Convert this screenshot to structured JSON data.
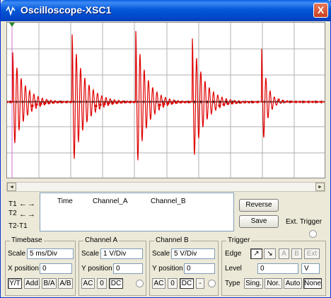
{
  "window": {
    "title": "Oscilloscope-XSC1",
    "close_label": "X"
  },
  "colors": {
    "trace": "#e00000",
    "grid": "#b0b0b0",
    "axis": "#000000",
    "title_bar": "#0458d8"
  },
  "cursors": {
    "t1": "T1",
    "t2": "T2",
    "diff": "T2-T1",
    "left_arrow": "←",
    "right_arrow": "→"
  },
  "readout": {
    "time_header": "Time",
    "channel_a_header": "Channel_A",
    "channel_b_header": "Channel_B"
  },
  "buttons": {
    "reverse": "Reverse",
    "save": "Save",
    "ext_trigger": "Ext. Trigger"
  },
  "timebase": {
    "title": "Timebase",
    "scale_label": "Scale",
    "scale_value": "5 ms/Div",
    "xpos_label": "X position",
    "xpos_value": "0",
    "modes": [
      "Y/T",
      "Add",
      "B/A",
      "A/B"
    ]
  },
  "channel_a": {
    "title": "Channel A",
    "scale_label": "Scale",
    "scale_value": "1  V/Div",
    "ypos_label": "Y position",
    "ypos_value": "0",
    "coupling": [
      "AC",
      "0",
      "DC"
    ]
  },
  "channel_b": {
    "title": "Channel B",
    "scale_label": "Scale",
    "scale_value": "5  V/Div",
    "ypos_label": "Y position",
    "ypos_value": "0",
    "coupling": [
      "AC",
      "0",
      "DC",
      "-"
    ]
  },
  "trigger": {
    "title": "Trigger",
    "edge_label": "Edge",
    "edge_buttons": [
      "↗",
      "↘",
      "A",
      "B",
      "Ext"
    ],
    "level_label": "Level",
    "level_value": "0",
    "level_unit": "V",
    "type_label": "Type",
    "types": [
      "Sing.",
      "Nor.",
      "Auto",
      "None"
    ]
  },
  "scrollbar": {
    "left": "◄",
    "right": "►"
  }
}
